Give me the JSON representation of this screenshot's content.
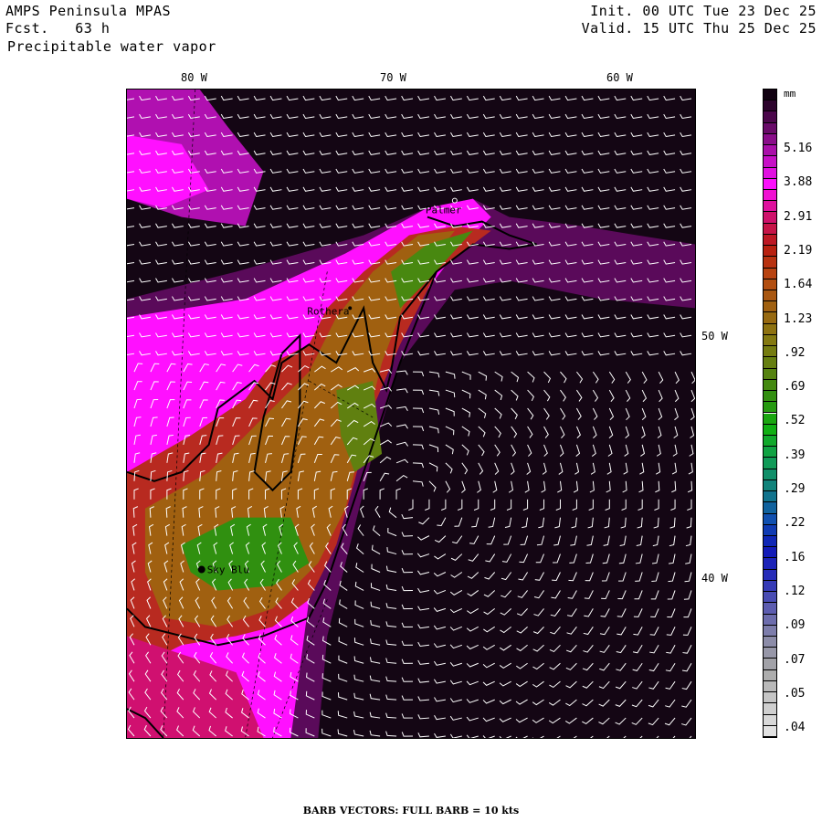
{
  "header": {
    "model": "AMPS Peninsula MPAS",
    "forecast": "Fcst.   63 h",
    "field": "Precipitable water vapor",
    "init": "Init. 00 UTC Tue 23 Dec 25",
    "valid": "Valid. 15 UTC Thu 25 Dec 25"
  },
  "axes": {
    "lon_labels": [
      "80 W",
      "70 W",
      "60 W"
    ],
    "lat_labels": [
      "50 W",
      "40 W"
    ]
  },
  "places": [
    "Palmer",
    "Rothera",
    "Sky Blu"
  ],
  "colorbar": {
    "unit": "mm",
    "labels": [
      "5.16",
      "3.88",
      "2.91",
      "2.19",
      "1.64",
      "1.23",
      ".92",
      ".69",
      ".52",
      ".39",
      ".29",
      ".22",
      ".16",
      ".12",
      ".09",
      ".07",
      ".05",
      ".04"
    ],
    "anchor_colors": [
      "#100010",
      "#600a60",
      "#b810b8",
      "#ff10ff",
      "#d01070",
      "#b81a10",
      "#b84810",
      "#a06010",
      "#887810",
      "#608010",
      "#309010",
      "#10b010",
      "#10a050",
      "#108080",
      "#1050b0",
      "#1018b8",
      "#2a30b8",
      "#6060b0",
      "#8a8aa8",
      "#a8a8a8",
      "#c8c8c8",
      "#e2e2e2"
    ]
  },
  "footer": "BARB VECTORS:  FULL BARB = 10 kts"
}
